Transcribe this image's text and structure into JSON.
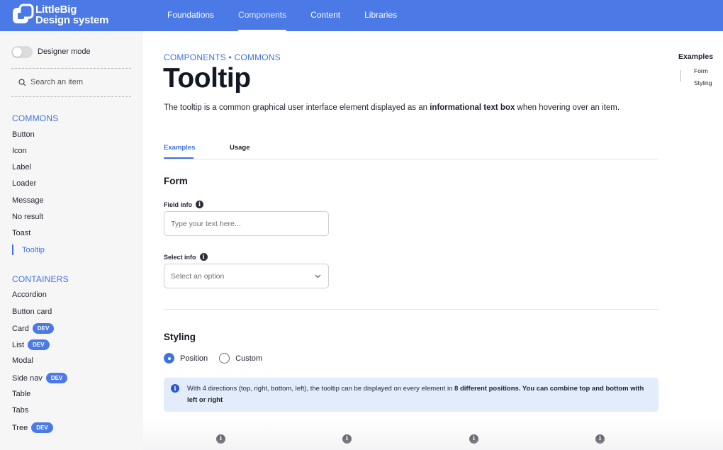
{
  "brand": {
    "line1": "LittleBig",
    "line2": "Design system"
  },
  "nav": [
    "Foundations",
    "Components",
    "Content",
    "Libraries"
  ],
  "sidebar": {
    "designer_mode": "Designer mode",
    "search_placeholder": "Search an item",
    "sections": [
      {
        "title": "COMMONS",
        "items": [
          "Button",
          "Icon",
          "Label",
          "Loader",
          "Message",
          "No result",
          "Toast",
          "Tooltip"
        ]
      },
      {
        "title": "CONTAINERS",
        "items": [
          "Accordion",
          "Button card",
          "Card",
          "List",
          "Modal",
          "Side nav",
          "Table",
          "Tabs",
          "Tree"
        ]
      }
    ],
    "badge": "DEV"
  },
  "main": {
    "breadcrumb": "COMPONENTS • COMMONS",
    "title": "Tooltip",
    "intro_pre": "The tooltip is a common graphical user interface element displayed as an ",
    "intro_bold": "informational text box",
    "intro_post": " when hovering over an item.",
    "tabs": [
      "Examples",
      "Usage"
    ],
    "form": {
      "heading": "Form",
      "field_label": "Field info",
      "field_placeholder": "Type your text here...",
      "select_label": "Select info",
      "select_value": "Select an option"
    },
    "styling": {
      "heading": "Styling",
      "radio_position": "Position",
      "radio_custom": "Custom",
      "notice_pre": "With 4 directions (top, right, bottom, left), the tooltip can be displayed on every element in ",
      "notice_bold": "8 different positions. You can combine top and bottom with left or right"
    }
  },
  "toc": {
    "title": "Examples",
    "items": [
      "Form",
      "Styling"
    ]
  },
  "colors": {
    "primary": "#4b79e6",
    "accent": "#3f73e0",
    "notice_bg": "#e3ecfb"
  }
}
